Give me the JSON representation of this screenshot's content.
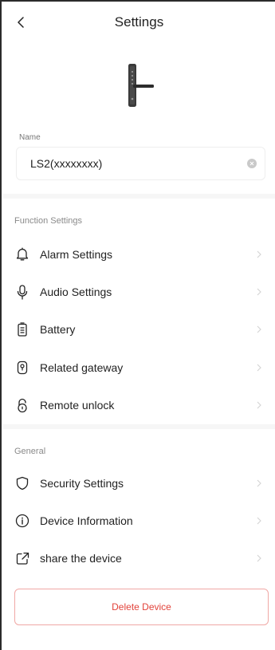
{
  "header": {
    "title": "Settings"
  },
  "device": {
    "image_icon": "smart-door-lock-icon"
  },
  "name_field": {
    "label": "Name",
    "value": "LS2(xxxxxxxx)"
  },
  "function_settings": {
    "section_label": "Function Settings",
    "items": [
      {
        "label": "Alarm Settings",
        "icon": "bell-icon"
      },
      {
        "label": "Audio Settings",
        "icon": "microphone-icon"
      },
      {
        "label": "Battery",
        "icon": "battery-icon"
      },
      {
        "label": "Related gateway",
        "icon": "gateway-icon"
      },
      {
        "label": "Remote unlock",
        "icon": "unlock-icon"
      }
    ]
  },
  "general": {
    "section_label": "General",
    "items": [
      {
        "label": "Security Settings",
        "icon": "shield-icon"
      },
      {
        "label": "Device Information",
        "icon": "info-icon"
      },
      {
        "label": "share the device",
        "icon": "share-icon"
      }
    ]
  },
  "delete_button": {
    "label": "Delete Device"
  },
  "colors": {
    "danger": "#e2433b",
    "danger_border": "#f0a8a5",
    "divider": "#f6f6f6"
  }
}
